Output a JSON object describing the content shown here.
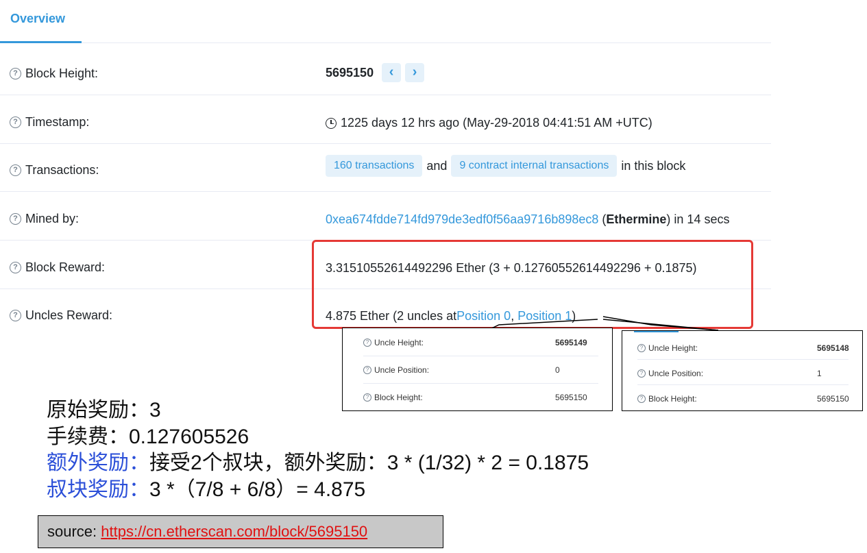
{
  "tab": {
    "label": "Overview"
  },
  "rows": {
    "block_height": {
      "label": "Block Height:",
      "value": "5695150",
      "prev": "‹",
      "next": "›"
    },
    "timestamp": {
      "label": "Timestamp:",
      "value": "1225 days 12 hrs ago (May-29-2018 04:41:51 AM +UTC)"
    },
    "transactions": {
      "label": "Transactions:",
      "tx_pill": "160 transactions",
      "and": "and",
      "internal_pill": "9 contract internal transactions",
      "suffix": "in this block"
    },
    "mined_by": {
      "label": "Mined by:",
      "address": "0xea674fdde714fd979de3edf0f56aa9716b898ec8",
      "open": "(",
      "pool": "Ethermine",
      "close": ") in 14 secs"
    },
    "block_reward": {
      "label": "Block Reward:",
      "value": "3.31510552614492296 Ether (3 + 0.12760552614492296 + 0.1875)"
    },
    "uncles_reward": {
      "label": "Uncles Reward:",
      "prefix": "4.875 Ether (2 uncles at ",
      "pos0": "Position 0",
      "comma": ", ",
      "pos1": "Position 1",
      "suffix": ")"
    }
  },
  "uncle_popups": [
    {
      "height_label": "Uncle Height:",
      "height": "5695149",
      "position_label": "Uncle Position:",
      "position": "0",
      "block_label": "Block Height:",
      "block": "5695150"
    },
    {
      "height_label": "Uncle Height:",
      "height": "5695148",
      "position_label": "Uncle Position:",
      "position": "1",
      "block_label": "Block Height:",
      "block": "5695150"
    }
  ],
  "notes": {
    "line1_label": "原始奖励：",
    "line1_value": "3",
    "line2_label": "手续费：",
    "line2_value": "0.127605526",
    "line3_label": "额外奖励：",
    "line3_mid": "接受",
    "line3_num": "2",
    "line3_rest": "个叔块，额外奖励：",
    "line3_value": "3 * (1/32) * 2 = 0.1875",
    "line4_label": "叔块奖励：",
    "line4_value": "3 *（7/8 + 6/8）= 4.875"
  },
  "source": {
    "label": "source: ",
    "url": "https://cn.etherscan.com/block/5695150"
  },
  "colors": {
    "link": "#3498db",
    "highlight": "#e53935",
    "note_blue": "#2b4fd8"
  }
}
